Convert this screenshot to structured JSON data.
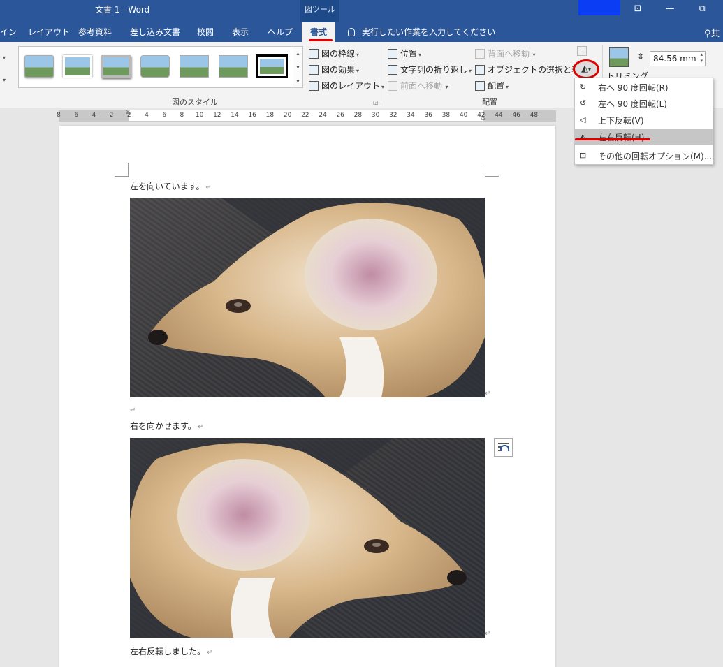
{
  "titlebar": {
    "doc_title": "文書 1 - Word",
    "context_group": "図ツール",
    "restore_label": "⧉",
    "minimize_label": "—",
    "ribbon_display_label": "⊡"
  },
  "tabs": [
    {
      "label": "イン"
    },
    {
      "label": "レイアウト"
    },
    {
      "label": "参考資料"
    },
    {
      "label": "差し込み文書"
    },
    {
      "label": "校閲"
    },
    {
      "label": "表示"
    },
    {
      "label": "ヘルプ"
    },
    {
      "label": "書式"
    }
  ],
  "tellme": {
    "label": "実行したい作業を入力してください"
  },
  "user": {
    "label": "共"
  },
  "ribbon": {
    "picture_styles": {
      "group_label": "図のスタイル",
      "border": "図の枠線",
      "effects": "図の効果",
      "layout": "図のレイアウト"
    },
    "arrange": {
      "group_label": "配置",
      "position": "位置",
      "wrap_text": "文字列の折り返し",
      "bring_forward": "前面へ移動",
      "send_backward": "背面へ移動",
      "selection_pane": "オブジェクトの選択と表示",
      "align": "配置"
    },
    "size": {
      "height_value": "84.56 mm",
      "crop_label": "トリミング"
    }
  },
  "ruler": {
    "ticks": [
      "8",
      "6",
      "4",
      "2",
      "2",
      "4",
      "6",
      "8",
      "10",
      "12",
      "14",
      "16",
      "18",
      "20",
      "22",
      "24",
      "26",
      "28",
      "30",
      "32",
      "34",
      "36",
      "38",
      "40",
      "42",
      "44",
      "46",
      "48"
    ]
  },
  "document": {
    "para1": "左を向いています。",
    "para2": "右を向かせます。",
    "para3": "左右反転しました。",
    "para_mark": "↵"
  },
  "rotate_menu": {
    "items": [
      {
        "label": "右へ 90 度回転(R)",
        "icon": "rotate-right-icon"
      },
      {
        "label": "左へ 90 度回転(L)",
        "icon": "rotate-left-icon"
      },
      {
        "label": "上下反転(V)",
        "icon": "flip-vertical-icon"
      },
      {
        "label": "左右反転(H)",
        "icon": "flip-horizontal-icon"
      },
      {
        "label": "その他の回転オプション(M)...",
        "icon": "rotation-options-icon"
      }
    ]
  },
  "colors": {
    "title_bar": "#2b579a",
    "annotation_red": "#e00000",
    "menu_hover": "#c6c6c6"
  }
}
